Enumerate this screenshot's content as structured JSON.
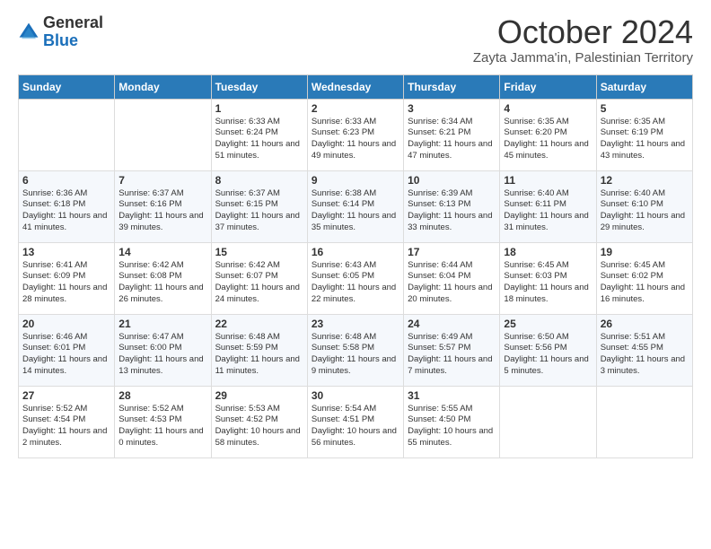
{
  "logo": {
    "general": "General",
    "blue": "Blue"
  },
  "title": "October 2024",
  "subtitle": "Zayta Jamma'in, Palestinian Territory",
  "days_of_week": [
    "Sunday",
    "Monday",
    "Tuesday",
    "Wednesday",
    "Thursday",
    "Friday",
    "Saturday"
  ],
  "weeks": [
    [
      {
        "day": "",
        "info": ""
      },
      {
        "day": "",
        "info": ""
      },
      {
        "day": "1",
        "info": "Sunrise: 6:33 AM\nSunset: 6:24 PM\nDaylight: 11 hours and 51 minutes."
      },
      {
        "day": "2",
        "info": "Sunrise: 6:33 AM\nSunset: 6:23 PM\nDaylight: 11 hours and 49 minutes."
      },
      {
        "day": "3",
        "info": "Sunrise: 6:34 AM\nSunset: 6:21 PM\nDaylight: 11 hours and 47 minutes."
      },
      {
        "day": "4",
        "info": "Sunrise: 6:35 AM\nSunset: 6:20 PM\nDaylight: 11 hours and 45 minutes."
      },
      {
        "day": "5",
        "info": "Sunrise: 6:35 AM\nSunset: 6:19 PM\nDaylight: 11 hours and 43 minutes."
      }
    ],
    [
      {
        "day": "6",
        "info": "Sunrise: 6:36 AM\nSunset: 6:18 PM\nDaylight: 11 hours and 41 minutes."
      },
      {
        "day": "7",
        "info": "Sunrise: 6:37 AM\nSunset: 6:16 PM\nDaylight: 11 hours and 39 minutes."
      },
      {
        "day": "8",
        "info": "Sunrise: 6:37 AM\nSunset: 6:15 PM\nDaylight: 11 hours and 37 minutes."
      },
      {
        "day": "9",
        "info": "Sunrise: 6:38 AM\nSunset: 6:14 PM\nDaylight: 11 hours and 35 minutes."
      },
      {
        "day": "10",
        "info": "Sunrise: 6:39 AM\nSunset: 6:13 PM\nDaylight: 11 hours and 33 minutes."
      },
      {
        "day": "11",
        "info": "Sunrise: 6:40 AM\nSunset: 6:11 PM\nDaylight: 11 hours and 31 minutes."
      },
      {
        "day": "12",
        "info": "Sunrise: 6:40 AM\nSunset: 6:10 PM\nDaylight: 11 hours and 29 minutes."
      }
    ],
    [
      {
        "day": "13",
        "info": "Sunrise: 6:41 AM\nSunset: 6:09 PM\nDaylight: 11 hours and 28 minutes."
      },
      {
        "day": "14",
        "info": "Sunrise: 6:42 AM\nSunset: 6:08 PM\nDaylight: 11 hours and 26 minutes."
      },
      {
        "day": "15",
        "info": "Sunrise: 6:42 AM\nSunset: 6:07 PM\nDaylight: 11 hours and 24 minutes."
      },
      {
        "day": "16",
        "info": "Sunrise: 6:43 AM\nSunset: 6:05 PM\nDaylight: 11 hours and 22 minutes."
      },
      {
        "day": "17",
        "info": "Sunrise: 6:44 AM\nSunset: 6:04 PM\nDaylight: 11 hours and 20 minutes."
      },
      {
        "day": "18",
        "info": "Sunrise: 6:45 AM\nSunset: 6:03 PM\nDaylight: 11 hours and 18 minutes."
      },
      {
        "day": "19",
        "info": "Sunrise: 6:45 AM\nSunset: 6:02 PM\nDaylight: 11 hours and 16 minutes."
      }
    ],
    [
      {
        "day": "20",
        "info": "Sunrise: 6:46 AM\nSunset: 6:01 PM\nDaylight: 11 hours and 14 minutes."
      },
      {
        "day": "21",
        "info": "Sunrise: 6:47 AM\nSunset: 6:00 PM\nDaylight: 11 hours and 13 minutes."
      },
      {
        "day": "22",
        "info": "Sunrise: 6:48 AM\nSunset: 5:59 PM\nDaylight: 11 hours and 11 minutes."
      },
      {
        "day": "23",
        "info": "Sunrise: 6:48 AM\nSunset: 5:58 PM\nDaylight: 11 hours and 9 minutes."
      },
      {
        "day": "24",
        "info": "Sunrise: 6:49 AM\nSunset: 5:57 PM\nDaylight: 11 hours and 7 minutes."
      },
      {
        "day": "25",
        "info": "Sunrise: 6:50 AM\nSunset: 5:56 PM\nDaylight: 11 hours and 5 minutes."
      },
      {
        "day": "26",
        "info": "Sunrise: 5:51 AM\nSunset: 4:55 PM\nDaylight: 11 hours and 3 minutes."
      }
    ],
    [
      {
        "day": "27",
        "info": "Sunrise: 5:52 AM\nSunset: 4:54 PM\nDaylight: 11 hours and 2 minutes."
      },
      {
        "day": "28",
        "info": "Sunrise: 5:52 AM\nSunset: 4:53 PM\nDaylight: 11 hours and 0 minutes."
      },
      {
        "day": "29",
        "info": "Sunrise: 5:53 AM\nSunset: 4:52 PM\nDaylight: 10 hours and 58 minutes."
      },
      {
        "day": "30",
        "info": "Sunrise: 5:54 AM\nSunset: 4:51 PM\nDaylight: 10 hours and 56 minutes."
      },
      {
        "day": "31",
        "info": "Sunrise: 5:55 AM\nSunset: 4:50 PM\nDaylight: 10 hours and 55 minutes."
      },
      {
        "day": "",
        "info": ""
      },
      {
        "day": "",
        "info": ""
      }
    ]
  ]
}
